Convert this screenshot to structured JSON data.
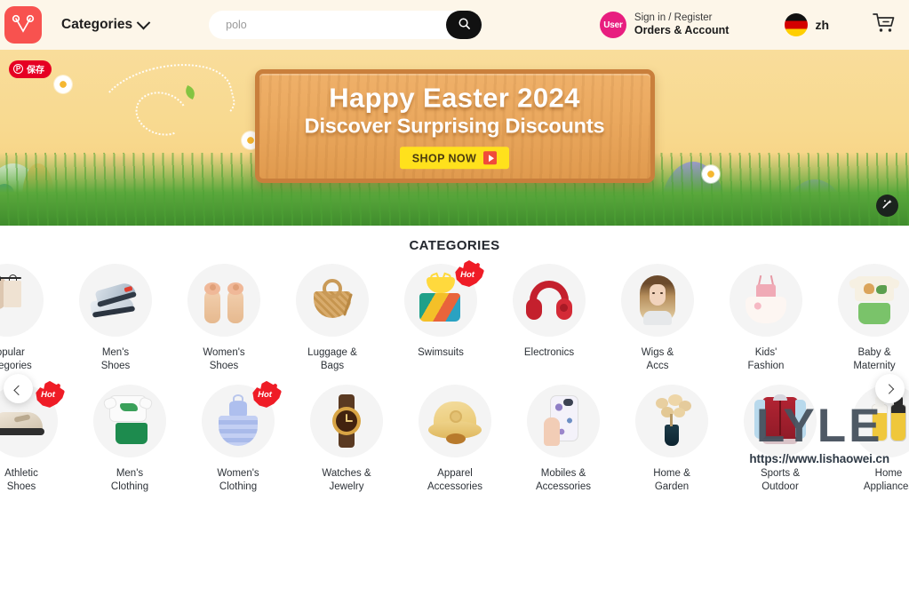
{
  "header": {
    "logo_icon": "shopping-bag-logo",
    "categories_label": "Categories",
    "chevron_icon": "chevron-down-icon",
    "search": {
      "placeholder": "polo",
      "value": "",
      "button_icon": "search-icon"
    },
    "account": {
      "avatar_text": "User",
      "line1": "Sign in / Register",
      "line2": "Orders & Account"
    },
    "language": {
      "flag_icon": "germany-flag-icon",
      "code": "zh"
    },
    "cart_icon": "shopping-cart-icon",
    "bg_color": "#fdf6e9"
  },
  "banner": {
    "pin_save": {
      "icon": "pinterest-icon",
      "label": "保存"
    },
    "title": "Happy Easter 2024",
    "subtitle": "Discover Surprising Discounts",
    "cta_label": "SHOP NOW",
    "cta_icon": "play-icon",
    "magic_icon": "magic-wand-icon",
    "accent_color": "#ffe11c"
  },
  "categories": {
    "heading": "CATEGORIES",
    "prev_icon": "chevron-left-icon",
    "next_icon": "chevron-right-icon",
    "hot_label": "Hot",
    "row1": [
      {
        "label": "Popular\nCategories",
        "art": "clothes-rack",
        "hot": false
      },
      {
        "label": "Men's\nShoes",
        "art": "sneakers",
        "hot": false
      },
      {
        "label": "Women's\nShoes",
        "art": "sandals",
        "hot": false
      },
      {
        "label": "Luggage &\nBags",
        "art": "straw-bag",
        "hot": false
      },
      {
        "label": "Swimsuits",
        "art": "swimsuit",
        "hot": true
      },
      {
        "label": "Electronics",
        "art": "headphones",
        "hot": false
      },
      {
        "label": "Wigs &\nAccs",
        "art": "wig",
        "hot": false
      },
      {
        "label": "Kids'\nFashion",
        "art": "kids-dress",
        "hot": false
      },
      {
        "label": "Baby &\nMaternity",
        "art": "baby-outfit",
        "hot": false
      }
    ],
    "row2": [
      {
        "label": "Athletic\nShoes",
        "art": "running-shoe",
        "hot": true
      },
      {
        "label": "Men's\nClothing",
        "art": "tshirt-shorts",
        "hot": false
      },
      {
        "label": "Women's\nClothing",
        "art": "blue-dress",
        "hot": true
      },
      {
        "label": "Watches &\nJewelry",
        "art": "watch",
        "hot": false
      },
      {
        "label": "Apparel\nAccessories",
        "art": "sun-hat",
        "hot": false
      },
      {
        "label": "Mobiles &\nAccessories",
        "art": "phone-case",
        "hot": false
      },
      {
        "label": "Home &\nGarden",
        "art": "vase-flowers",
        "hot": false
      },
      {
        "label": "Sports &\nOutdoor",
        "art": "cycling-jersey",
        "hot": false
      },
      {
        "label": "Home\nAppliances",
        "art": "oil-sprayers",
        "hot": false
      }
    ]
  },
  "watermark": {
    "logo": "LYLE",
    "url": "https://www.lishaowei.cn"
  }
}
